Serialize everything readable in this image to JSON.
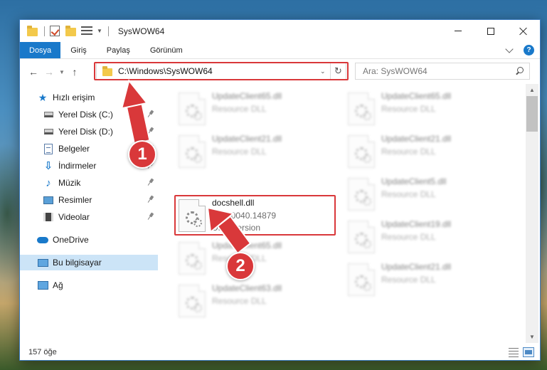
{
  "window": {
    "title": "SysWOW64",
    "controls": [
      "minimize",
      "maximize",
      "close"
    ]
  },
  "ribbon": {
    "tabs": [
      {
        "label": "Dosya",
        "active": true
      },
      {
        "label": "Giriş",
        "active": false
      },
      {
        "label": "Paylaş",
        "active": false
      },
      {
        "label": "Görünüm",
        "active": false
      }
    ],
    "help": "?"
  },
  "address": {
    "path": "C:\\Windows\\SysWOW64"
  },
  "search": {
    "placeholder": "Ara: SysWOW64"
  },
  "sidebar": {
    "items": [
      {
        "label": "Hızlı erişim",
        "icon": "star-icon",
        "pinned": false
      },
      {
        "label": "Yerel Disk (C:)",
        "icon": "drive-icon",
        "pinned": true
      },
      {
        "label": "Yerel Disk (D:)",
        "icon": "drive-icon",
        "pinned": true
      },
      {
        "label": "Belgeler",
        "icon": "documents-icon",
        "pinned": true
      },
      {
        "label": "İndirmeler",
        "icon": "downloads-icon",
        "pinned": true
      },
      {
        "label": "Müzik",
        "icon": "music-icon",
        "pinned": true
      },
      {
        "label": "Resimler",
        "icon": "pictures-icon",
        "pinned": true
      },
      {
        "label": "Videolar",
        "icon": "videos-icon",
        "pinned": true
      },
      {
        "label": "OneDrive",
        "icon": "onedrive-icon",
        "pinned": false
      },
      {
        "label": "Bu bilgisayar",
        "icon": "this-pc-icon",
        "pinned": false,
        "selected": true
      },
      {
        "label": "Ağ",
        "icon": "network-icon",
        "pinned": false
      }
    ]
  },
  "files": {
    "left": [
      {
        "name": "UpdateClient65.dll",
        "line1": "Resource DLL",
        "line2": ""
      },
      {
        "name": "UpdateClient21.dll",
        "line1": "Resource DLL",
        "line2": ""
      },
      {
        "name": "docshell.dll",
        "line1": "1.7.20040.14879",
        "line2": "DFileVersion",
        "highlighted": true
      },
      {
        "name": "UpdateClient65.dll",
        "line1": "Resource DLL",
        "line2": ""
      },
      {
        "name": "UpdateClient63.dll",
        "line1": "Resource DLL",
        "line2": ""
      }
    ],
    "right": [
      {
        "name": "UpdateClient65.dll",
        "line1": "Resource DLL",
        "line2": ""
      },
      {
        "name": "UpdateClient21.dll",
        "line1": "Resource DLL",
        "line2": ""
      },
      {
        "name": "UpdateClient5.dll",
        "line1": "Resource DLL",
        "line2": ""
      },
      {
        "name": "UpdateClient19.dll",
        "line1": "Resource DLL",
        "line2": ""
      },
      {
        "name": "UpdateClient21.dll",
        "line1": "Resource DLL",
        "line2": ""
      }
    ]
  },
  "status": {
    "item_count": "157 öğe"
  },
  "annotations": {
    "step1": "1",
    "step2": "2",
    "color": "#d9383a"
  }
}
